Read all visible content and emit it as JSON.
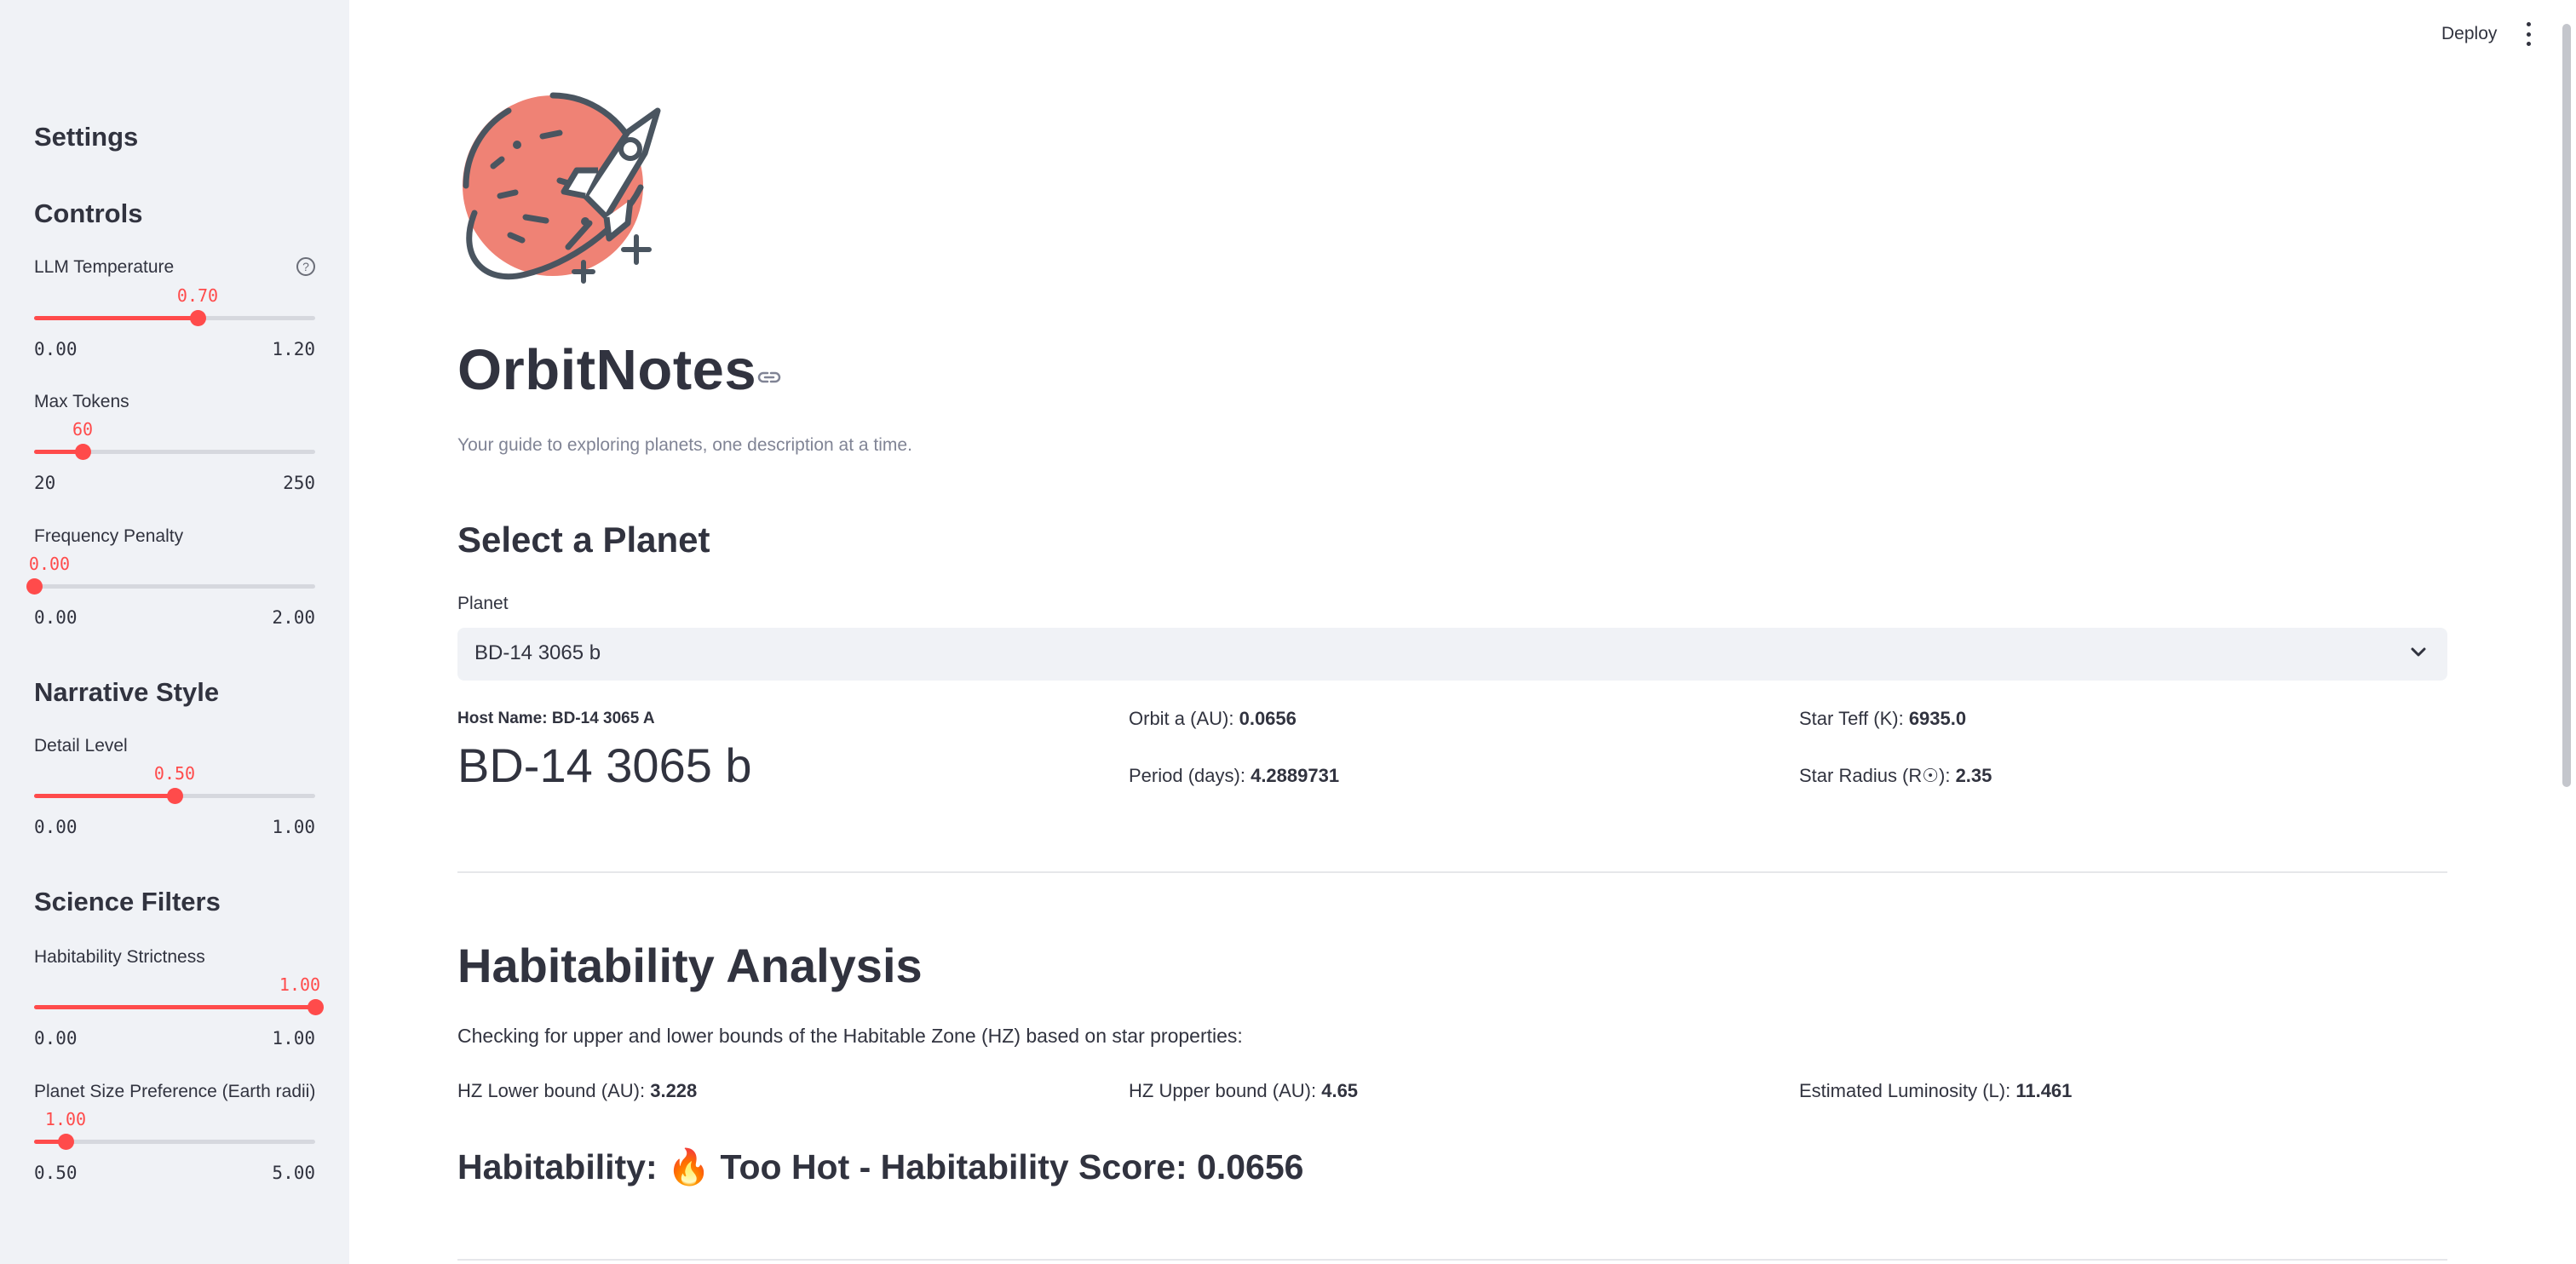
{
  "header": {
    "deploy_label": "Deploy",
    "menu_icon": "kebab-menu-icon"
  },
  "sidebar": {
    "title": "Settings",
    "sections": {
      "controls": "Controls",
      "narrative": "Narrative Style",
      "science": "Science Filters"
    },
    "sliders": {
      "llm_temperature": {
        "label": "LLM Temperature",
        "value": "0.70",
        "min": "0.00",
        "max": "1.20",
        "fraction": 0.583
      },
      "max_tokens": {
        "label": "Max Tokens",
        "value": "60",
        "min": "20",
        "max": "250",
        "fraction": 0.174
      },
      "frequency_penalty": {
        "label": "Frequency Penalty",
        "value": "0.00",
        "min": "0.00",
        "max": "2.00",
        "fraction": 0.0
      },
      "detail_level": {
        "label": "Detail Level",
        "value": "0.50",
        "min": "0.00",
        "max": "1.00",
        "fraction": 0.5
      },
      "habitability_strictness": {
        "label": "Habitability Strictness",
        "value": "1.00",
        "min": "0.00",
        "max": "1.00",
        "fraction": 1.0
      },
      "planet_size": {
        "label": "Planet Size Preference (Earth radii)",
        "value": "1.00",
        "min": "0.50",
        "max": "5.00",
        "fraction": 0.111
      }
    }
  },
  "main": {
    "title": "OrbitNotes",
    "subtitle": "Your guide to exploring planets, one description at a time.",
    "select_heading": "Select a Planet",
    "select_label": "Planet",
    "selected_planet": "BD-14 3065 b",
    "host_name_label": "Host Name:",
    "host_name_value": "BD-14 3065 A",
    "planet_name": "BD-14 3065 b",
    "orbit_label": "Orbit a (AU):",
    "orbit_value": "0.0656",
    "period_label": "Period (days):",
    "period_value": "4.2889731",
    "teff_label": "Star Teff (K):",
    "teff_value": "6935.0",
    "radius_label": "Star Radius (R☉):",
    "radius_value": "2.35",
    "hab_heading": "Habitability Analysis",
    "hab_desc": "Checking for upper and lower bounds of the Habitable Zone (HZ) based on star properties:",
    "hz_lower_label": "HZ Lower bound (AU):",
    "hz_lower_value": "3.228",
    "hz_upper_label": "HZ Upper bound (AU):",
    "hz_upper_value": "4.65",
    "lum_label": "Estimated Luminosity (L):",
    "lum_value": "11.461",
    "hab_result": "Habitability: 🔥 Too Hot - Habitability Score: 0.0656"
  },
  "colors": {
    "accent": "#ff4b4b",
    "sidebar_bg": "#f0f2f6",
    "text": "#31333f",
    "muted": "#808495",
    "logo_planet": "#ef8275",
    "logo_stroke": "#4a5560"
  }
}
